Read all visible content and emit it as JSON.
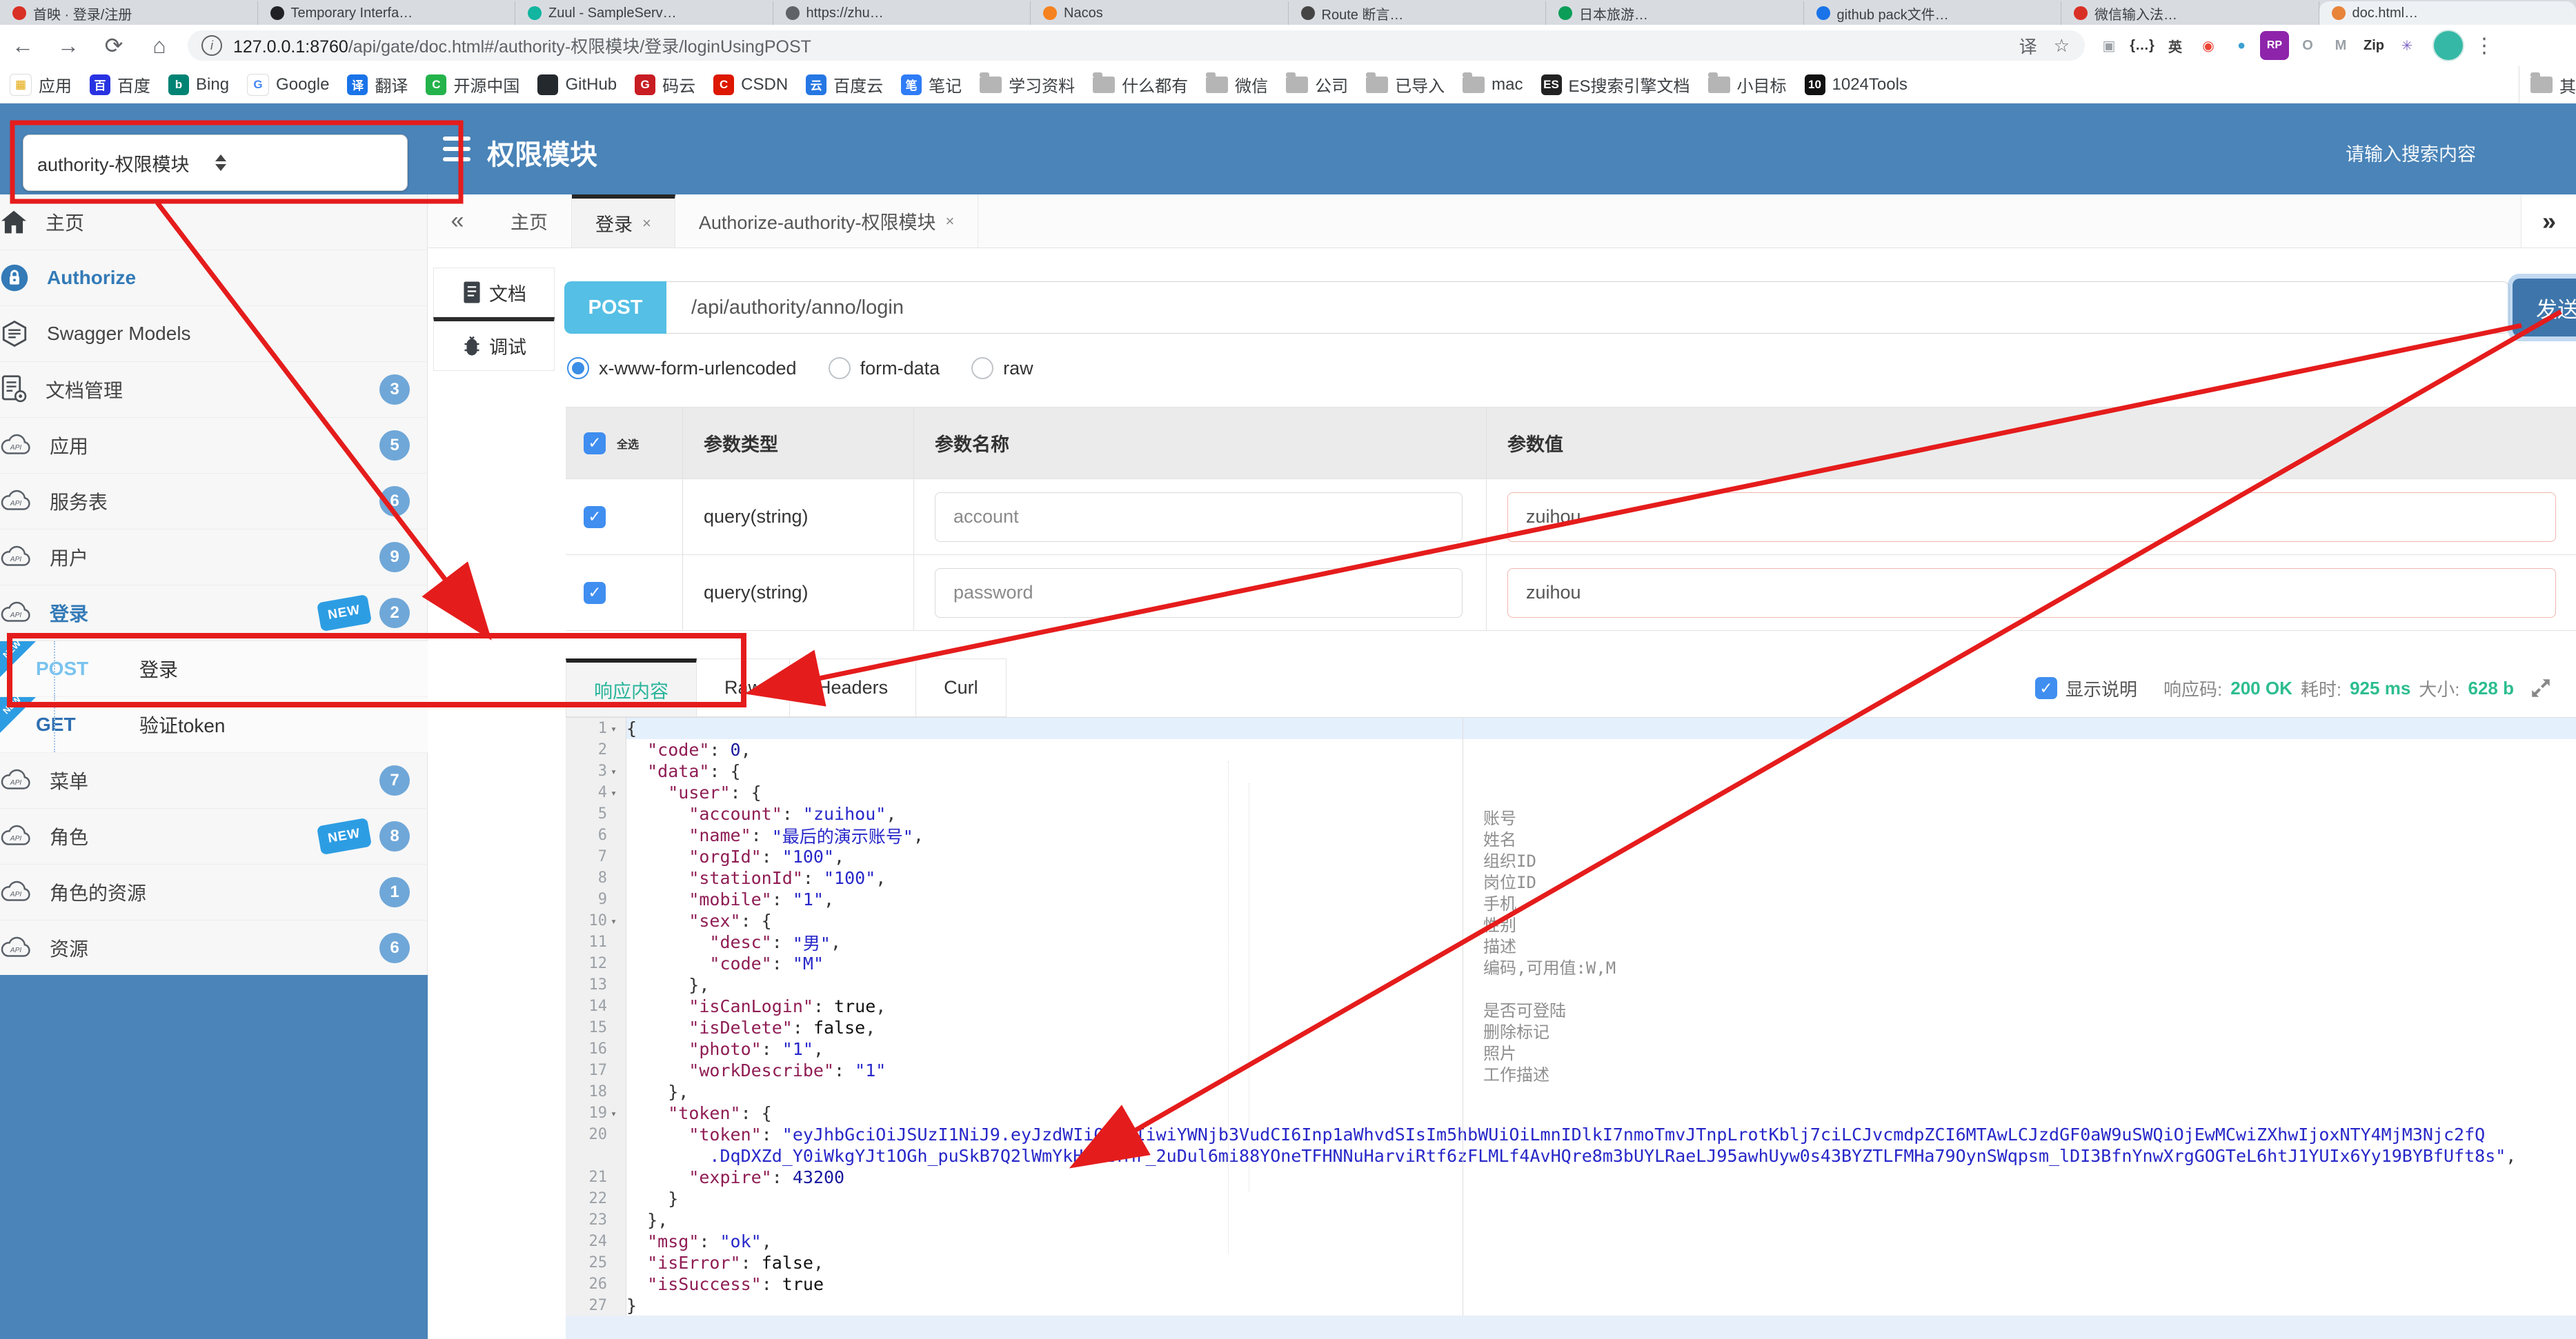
{
  "browser": {
    "tabs": [
      {
        "title": "首映 · 登录/注册",
        "color": "#d93025"
      },
      {
        "title": "Temporary Interfa…",
        "color": "#202124"
      },
      {
        "title": "Zuul - SampleServ…",
        "color": "#12b5a0"
      },
      {
        "title": "https://zhu…",
        "color": "#5f6368"
      },
      {
        "title": "Nacos",
        "color": "#f58220"
      },
      {
        "title": "Route 断言…",
        "color": "#444444"
      },
      {
        "title": "日本旅游…",
        "color": "#0c9d58"
      },
      {
        "title": "github pack文件…",
        "color": "#1a73e8"
      },
      {
        "title": "微信输入法…",
        "color": "#d93025"
      },
      {
        "title": "doc.html…",
        "color": "#e8833a",
        "active": true
      }
    ],
    "toolbar": {
      "url_host": "127.0.0.1:8760",
      "url_path": "/api/gate/doc.html#/authority-权限模块/登录/loginUsingPOST",
      "translate_glyph": "译",
      "star_glyph": "☆",
      "extensions": [
        {
          "name": "extension-grid-icon",
          "glyph": "▣",
          "fg": "#9aa0a6",
          "bg": "transparent"
        },
        {
          "name": "extension-json-icon",
          "glyph": "{…}",
          "fg": "#333333",
          "bg": "transparent"
        },
        {
          "name": "extension-translate-icon",
          "glyph": "英",
          "fg": "#444444",
          "bg": "transparent"
        },
        {
          "name": "extension-chrome-icon",
          "glyph": "◉",
          "fg": "#ea4335",
          "bg": "transparent"
        },
        {
          "name": "extension-globe-icon",
          "glyph": "●",
          "fg": "#3ba0d0",
          "bg": "transparent"
        },
        {
          "name": "extension-rp-icon",
          "glyph": "RP",
          "fg": "#ffffff",
          "bg": "#8e24aa"
        },
        {
          "name": "extension-o-icon",
          "glyph": "O",
          "fg": "#9aa0a6",
          "bg": "transparent"
        },
        {
          "name": "extension-m-icon",
          "glyph": "M",
          "fg": "#9aa0a6",
          "bg": "transparent"
        },
        {
          "name": "extension-gitzip-icon",
          "glyph": "Zip",
          "fg": "#333333",
          "bg": "transparent"
        },
        {
          "name": "extension-asterisk-icon",
          "glyph": "✳",
          "fg": "#7b61c4",
          "bg": "transparent"
        }
      ],
      "menu_glyph": "⋮"
    },
    "bookmarks": [
      {
        "label": "应用",
        "ch": "▦",
        "bg": "#ffffff",
        "fg": "#e2a400"
      },
      {
        "label": "百度",
        "ch": "百",
        "bg": "#2932e1",
        "fg": "#ffffff"
      },
      {
        "label": "Bing",
        "ch": "b",
        "bg": "#008373",
        "fg": "#ffffff"
      },
      {
        "label": "Google",
        "ch": "G",
        "bg": "#ffffff",
        "fg": "#4285f4"
      },
      {
        "label": "翻译",
        "ch": "译",
        "bg": "#1a73e8",
        "fg": "#ffffff"
      },
      {
        "label": "开源中国",
        "ch": "C",
        "bg": "#24b34b",
        "fg": "#ffffff"
      },
      {
        "label": "GitHub",
        "ch": "",
        "bg": "#24292e",
        "fg": "#ffffff"
      },
      {
        "label": "码云",
        "ch": "G",
        "bg": "#c71d23",
        "fg": "#ffffff"
      },
      {
        "label": "CSDN",
        "ch": "C",
        "bg": "#dd1700",
        "fg": "#ffffff"
      },
      {
        "label": "百度云",
        "ch": "云",
        "bg": "#2577e3",
        "fg": "#ffffff"
      },
      {
        "label": "笔记",
        "ch": "笔",
        "bg": "#2f7cf6",
        "fg": "#ffffff"
      },
      {
        "label": "学习资料",
        "folder": true
      },
      {
        "label": "什么都有",
        "folder": true
      },
      {
        "label": "微信",
        "folder": true
      },
      {
        "label": "公司",
        "folder": true
      },
      {
        "label": "已导入",
        "folder": true
      },
      {
        "label": "mac",
        "folder": true
      },
      {
        "label": "ES搜索引擎文档",
        "ch": "ES",
        "bg": "#222222",
        "fg": "#ffffff"
      },
      {
        "label": "小目标",
        "folder": true
      },
      {
        "label": "1024Tools",
        "ch": "10",
        "bg": "#111111",
        "fg": "#ffffff"
      }
    ],
    "bookmarks_right": {
      "label": "其"
    }
  },
  "header": {
    "module_select": "authority-权限模块",
    "title": "权限模块",
    "search_placeholder": "请输入搜索内容"
  },
  "sidebar": {
    "items": [
      {
        "kind": "row",
        "icon": "home-icon",
        "label": "主页"
      },
      {
        "kind": "row",
        "icon": "lock-icon",
        "label": "Authorize",
        "active": true
      },
      {
        "kind": "row",
        "icon": "models-icon",
        "label": "Swagger Models"
      },
      {
        "kind": "row",
        "icon": "doc-manage-icon",
        "label": "文档管理",
        "badge": "3"
      },
      {
        "kind": "row",
        "icon": "cloud-api-icon",
        "label": "应用",
        "badge": "5"
      },
      {
        "kind": "row",
        "icon": "cloud-api-icon",
        "label": "服务表",
        "badge": "6"
      },
      {
        "kind": "row",
        "icon": "cloud-api-icon",
        "label": "用户",
        "badge": "9"
      },
      {
        "kind": "row",
        "icon": "cloud-api-icon",
        "label": "登录",
        "badge": "2",
        "new": true,
        "active": true
      },
      {
        "kind": "op",
        "method": "POST",
        "label": "登录",
        "new": true
      },
      {
        "kind": "op",
        "method": "GET",
        "label": "验证token",
        "new": true
      },
      {
        "kind": "row",
        "icon": "cloud-api-icon",
        "label": "菜单",
        "badge": "7"
      },
      {
        "kind": "row",
        "icon": "cloud-api-icon",
        "label": "角色",
        "badge": "8",
        "new": true
      },
      {
        "kind": "row",
        "icon": "cloud-api-icon",
        "label": "角色的资源",
        "badge": "1"
      },
      {
        "kind": "row",
        "icon": "cloud-api-icon",
        "label": "资源",
        "badge": "6"
      }
    ]
  },
  "content": {
    "collapse_glyph": "«",
    "expand_glyph": "»",
    "tabs": [
      {
        "label": "主页"
      },
      {
        "label": "登录",
        "close": "×",
        "active": true
      },
      {
        "label": "Authorize-authority-权限模块",
        "close": "×"
      }
    ],
    "rail": [
      {
        "label": "文档",
        "icon": "doc-icon"
      },
      {
        "label": "调试",
        "icon": "debug-icon",
        "active": true
      }
    ]
  },
  "request": {
    "method": "POST",
    "path": "/api/authority/anno/login",
    "send_label": "发送",
    "body_types": [
      {
        "label": "x-www-form-urlencoded",
        "selected": true
      },
      {
        "label": "form-data"
      },
      {
        "label": "raw"
      }
    ]
  },
  "params": {
    "select_all_label": "全选",
    "headers": [
      "参数类型",
      "参数名称",
      "参数值"
    ],
    "rows": [
      {
        "checked": true,
        "type": "query(string)",
        "name": "account",
        "value": "zuihou"
      },
      {
        "checked": true,
        "type": "query(string)",
        "name": "password",
        "value": "zuihou"
      }
    ]
  },
  "response": {
    "tabs": [
      {
        "label": "响应内容",
        "active": true
      },
      {
        "label": "Raw"
      },
      {
        "label": "Headers"
      },
      {
        "label": "Curl"
      }
    ],
    "show_desc_label": "显示说明",
    "meta": {
      "code_label": "响应码:",
      "code_value": "200 OK",
      "time_label": "耗时:",
      "time_value": "925 ms",
      "size_label": "大小:",
      "size_value": "628 b"
    },
    "code": {
      "lines": [
        {
          "n": 1,
          "fold": true,
          "hl": true,
          "seg": [
            [
              "pun",
              "{"
            ]
          ]
        },
        {
          "n": 2,
          "seg": [
            [
              "pun",
              "  "
            ],
            [
              "key",
              "\"code\""
            ],
            [
              "pun",
              ": "
            ],
            [
              "num",
              "0"
            ],
            [
              "pun",
              ","
            ]
          ]
        },
        {
          "n": 3,
          "fold": true,
          "seg": [
            [
              "pun",
              "  "
            ],
            [
              "key",
              "\"data\""
            ],
            [
              "pun",
              ": {"
            ]
          ]
        },
        {
          "n": 4,
          "fold": true,
          "seg": [
            [
              "pun",
              "    "
            ],
            [
              "key",
              "\"user\""
            ],
            [
              "pun",
              ": {"
            ]
          ]
        },
        {
          "n": 5,
          "desc": "账号",
          "seg": [
            [
              "pun",
              "      "
            ],
            [
              "key",
              "\"account\""
            ],
            [
              "pun",
              ": "
            ],
            [
              "str",
              "\"zuihou\""
            ],
            [
              "pun",
              ","
            ]
          ]
        },
        {
          "n": 6,
          "desc": "姓名",
          "seg": [
            [
              "pun",
              "      "
            ],
            [
              "key",
              "\"name\""
            ],
            [
              "pun",
              ": "
            ],
            [
              "str",
              "\"最后的演示账号\""
            ],
            [
              "pun",
              ","
            ]
          ]
        },
        {
          "n": 7,
          "desc": "组织ID",
          "seg": [
            [
              "pun",
              "      "
            ],
            [
              "key",
              "\"orgId\""
            ],
            [
              "pun",
              ": "
            ],
            [
              "str",
              "\"100\""
            ],
            [
              "pun",
              ","
            ]
          ]
        },
        {
          "n": 8,
          "desc": "岗位ID",
          "seg": [
            [
              "pun",
              "      "
            ],
            [
              "key",
              "\"stationId\""
            ],
            [
              "pun",
              ": "
            ],
            [
              "str",
              "\"100\""
            ],
            [
              "pun",
              ","
            ]
          ]
        },
        {
          "n": 9,
          "desc": "手机",
          "seg": [
            [
              "pun",
              "      "
            ],
            [
              "key",
              "\"mobile\""
            ],
            [
              "pun",
              ": "
            ],
            [
              "str",
              "\"1\""
            ],
            [
              "pun",
              ","
            ]
          ]
        },
        {
          "n": 10,
          "fold": true,
          "desc": "性别",
          "seg": [
            [
              "pun",
              "      "
            ],
            [
              "key",
              "\"sex\""
            ],
            [
              "pun",
              ": {"
            ]
          ]
        },
        {
          "n": 11,
          "desc": "描述",
          "seg": [
            [
              "pun",
              "        "
            ],
            [
              "key",
              "\"desc\""
            ],
            [
              "pun",
              ": "
            ],
            [
              "str",
              "\"男\""
            ],
            [
              "pun",
              ","
            ]
          ]
        },
        {
          "n": 12,
          "desc": "编码,可用值:W,M",
          "seg": [
            [
              "pun",
              "        "
            ],
            [
              "key",
              "\"code\""
            ],
            [
              "pun",
              ": "
            ],
            [
              "str",
              "\"M\""
            ]
          ]
        },
        {
          "n": 13,
          "seg": [
            [
              "pun",
              "      },"
            ]
          ]
        },
        {
          "n": 14,
          "desc": "是否可登陆",
          "seg": [
            [
              "pun",
              "      "
            ],
            [
              "key",
              "\"isCanLogin\""
            ],
            [
              "pun",
              ": "
            ],
            [
              "boo",
              "true"
            ],
            [
              "pun",
              ","
            ]
          ]
        },
        {
          "n": 15,
          "desc": "删除标记",
          "seg": [
            [
              "pun",
              "      "
            ],
            [
              "key",
              "\"isDelete\""
            ],
            [
              "pun",
              ": "
            ],
            [
              "boo",
              "false"
            ],
            [
              "pun",
              ","
            ]
          ]
        },
        {
          "n": 16,
          "desc": "照片",
          "seg": [
            [
              "pun",
              "      "
            ],
            [
              "key",
              "\"photo\""
            ],
            [
              "pun",
              ": "
            ],
            [
              "str",
              "\"1\""
            ],
            [
              "pun",
              ","
            ]
          ]
        },
        {
          "n": 17,
          "desc": "工作描述",
          "seg": [
            [
              "pun",
              "      "
            ],
            [
              "key",
              "\"workDescribe\""
            ],
            [
              "pun",
              ": "
            ],
            [
              "str",
              "\"1\""
            ]
          ]
        },
        {
          "n": 18,
          "seg": [
            [
              "pun",
              "    },"
            ]
          ]
        },
        {
          "n": 19,
          "fold": true,
          "seg": [
            [
              "pun",
              "    "
            ],
            [
              "key",
              "\"token\""
            ],
            [
              "pun",
              ": {"
            ]
          ]
        },
        {
          "n": 20,
          "seg": [
            [
              "pun",
              "      "
            ],
            [
              "key",
              "\"token\""
            ],
            [
              "pun",
              ": "
            ],
            [
              "str",
              "\"eyJhbGciOiJSUzI1NiJ9.eyJzdWIiOiIyIiwiYWNjb3VudCI6Inp1aWhvdSIsIm5hbWUiOiLmnIDlkI7nmoTmvJTnpLrotKblj7ciLCJvcmdpZCI6MTAwLCJzdGF0aW9uSWQiOjEwMCwiZXhwIjoxNTY4MjM3Njc2fQ"
            ]
          ]
        },
        {
          "n": null,
          "seg": [
            [
              "pun",
              "        "
            ],
            [
              "str",
              ".DqDXZd_Y0iWkgYJt1OGh_puSkB7Q2lWmYkH9RZYMr_2uDul6mi88YOneTFHNNuHarviRtf6zFLMLf4AvHQre8m3bUYLRaeLJ95awhUyw0s43BYZTLFMHa79OynSWqpsm_lDI3BfnYnwXrgGOGTeL6htJ1YUIx6Yy19BYBfUft8s\""
            ],
            [
              "pun",
              ","
            ]
          ]
        },
        {
          "n": 21,
          "seg": [
            [
              "pun",
              "      "
            ],
            [
              "key",
              "\"expire\""
            ],
            [
              "pun",
              ": "
            ],
            [
              "num",
              "43200"
            ]
          ]
        },
        {
          "n": 22,
          "seg": [
            [
              "pun",
              "    }"
            ]
          ]
        },
        {
          "n": 23,
          "seg": [
            [
              "pun",
              "  },"
            ]
          ]
        },
        {
          "n": 24,
          "seg": [
            [
              "pun",
              "  "
            ],
            [
              "key",
              "\"msg\""
            ],
            [
              "pun",
              ": "
            ],
            [
              "str",
              "\"ok\""
            ],
            [
              "pun",
              ","
            ]
          ]
        },
        {
          "n": 25,
          "seg": [
            [
              "pun",
              "  "
            ],
            [
              "key",
              "\"isError\""
            ],
            [
              "pun",
              ": "
            ],
            [
              "boo",
              "false"
            ],
            [
              "pun",
              ","
            ]
          ]
        },
        {
          "n": 26,
          "seg": [
            [
              "pun",
              "  "
            ],
            [
              "key",
              "\"isSuccess\""
            ],
            [
              "pun",
              ": "
            ],
            [
              "boo",
              "true"
            ]
          ]
        },
        {
          "n": 27,
          "seg": [
            [
              "pun",
              "}"
            ]
          ]
        }
      ]
    }
  },
  "colors": {
    "header_blue": "#4a84b8",
    "accent_blue": "#337ab7",
    "post_chip": "#55bfe5",
    "success_green": "#2dbd8f",
    "annotation_red": "#e51c1c"
  }
}
